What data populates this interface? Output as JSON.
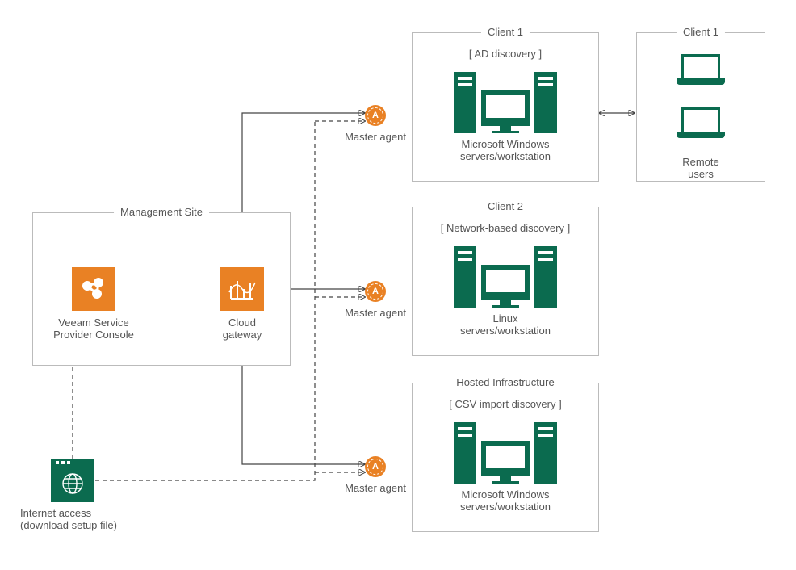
{
  "management_site": {
    "title": "Management Site",
    "vspc_label_line1": "Veeam Service",
    "vspc_label_line2": "Provider Console",
    "gw_label_line1": "Cloud",
    "gw_label_line2": "gateway"
  },
  "internet": {
    "label_line1": "Internet  access",
    "label_line2": "(download setup file)"
  },
  "agents": {
    "a1": "Master agent",
    "a2": "Master agent",
    "a3": "Master agent",
    "letter": "A"
  },
  "client1": {
    "title": "Client 1",
    "subtitle": "[ AD discovery ]",
    "workload_line1": "Microsoft Windows",
    "workload_line2": "servers/workstation"
  },
  "client1_remote": {
    "title": "Client 1",
    "label": "Remote users"
  },
  "client2": {
    "title": "Client 2",
    "subtitle": "[ Network-based discovery ]",
    "workload_line1": "Linux",
    "workload_line2": "servers/workstation"
  },
  "hosted": {
    "title": "Hosted Infrastructure",
    "subtitle": "[ CSV import discovery ]",
    "workload_line1": "Microsoft Windows",
    "workload_line2": "servers/workstation"
  }
}
